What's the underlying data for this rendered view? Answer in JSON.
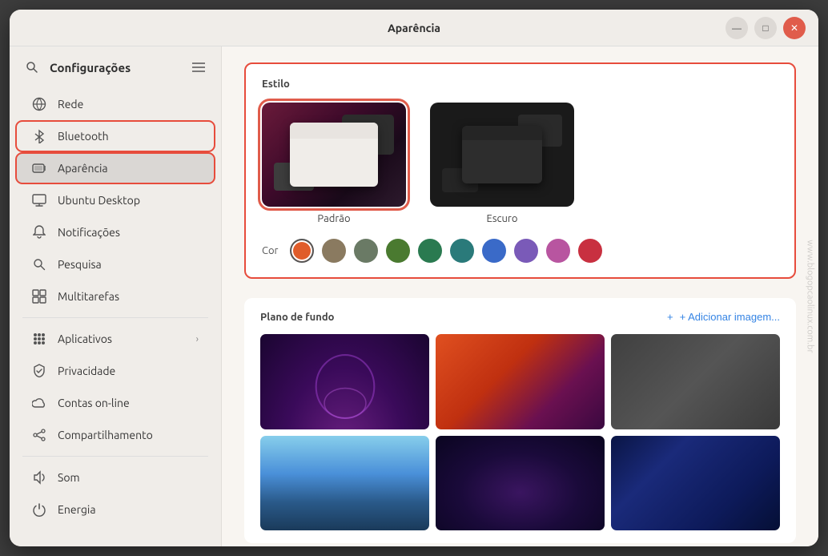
{
  "window": {
    "title": "Aparência",
    "controls": {
      "minimize": "—",
      "maximize": "□",
      "close": "✕"
    }
  },
  "sidebar": {
    "title": "Configurações",
    "items": [
      {
        "id": "rede",
        "label": "Rede",
        "icon": "network"
      },
      {
        "id": "bluetooth",
        "label": "Bluetooth",
        "icon": "bluetooth"
      },
      {
        "id": "aparencia",
        "label": "Aparência",
        "icon": "appearance",
        "active": true
      },
      {
        "id": "ubuntu-desktop",
        "label": "Ubuntu Desktop",
        "icon": "desktop"
      },
      {
        "id": "notificacoes",
        "label": "Notificações",
        "icon": "bell"
      },
      {
        "id": "pesquisa",
        "label": "Pesquisa",
        "icon": "search"
      },
      {
        "id": "multitarefas",
        "label": "Multitarefas",
        "icon": "multitask"
      },
      {
        "id": "aplicativos",
        "label": "Aplicativos",
        "icon": "apps",
        "arrow": true
      },
      {
        "id": "privacidade",
        "label": "Privacidade",
        "icon": "privacy"
      },
      {
        "id": "contas-online",
        "label": "Contas on-line",
        "icon": "cloud"
      },
      {
        "id": "compartilhamento",
        "label": "Compartilhamento",
        "icon": "share"
      },
      {
        "id": "som",
        "label": "Som",
        "icon": "sound"
      },
      {
        "id": "energia",
        "label": "Energia",
        "icon": "power"
      }
    ]
  },
  "main": {
    "style_section": {
      "title": "Estilo",
      "themes": [
        {
          "id": "padrao",
          "label": "Padrão",
          "selected": true
        },
        {
          "id": "escuro",
          "label": "Escuro",
          "selected": false
        }
      ],
      "color_label": "Cor",
      "colors": [
        {
          "id": "orange",
          "hex": "#e05c2a",
          "selected": true
        },
        {
          "id": "bark",
          "hex": "#8a7a60"
        },
        {
          "id": "sage",
          "hex": "#6a7a65"
        },
        {
          "id": "olive",
          "hex": "#4a7a30"
        },
        {
          "id": "viridian",
          "hex": "#2a7a50"
        },
        {
          "id": "prussian",
          "hex": "#2a7a7a"
        },
        {
          "id": "blue",
          "hex": "#3a6ac8"
        },
        {
          "id": "purple",
          "hex": "#7a5ab8"
        },
        {
          "id": "magenta",
          "hex": "#b855a0"
        },
        {
          "id": "red",
          "hex": "#c83040"
        }
      ]
    },
    "wallpaper_section": {
      "title": "Plano de fundo",
      "add_button": "+ Adicionar imagem..."
    }
  },
  "watermark": "www.blogopcaolinux.com.br"
}
